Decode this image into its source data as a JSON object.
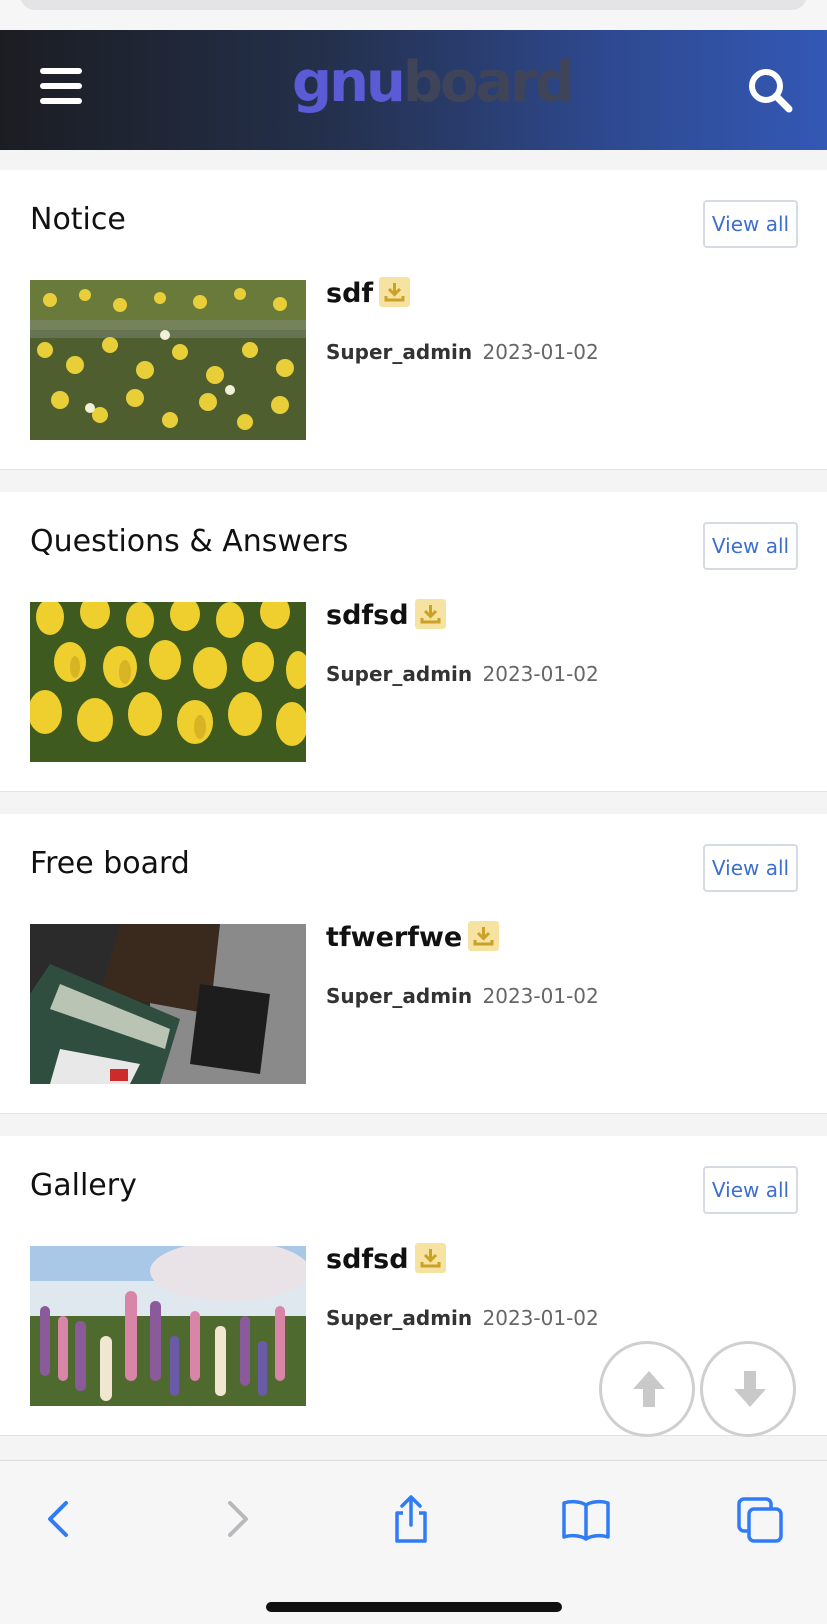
{
  "header": {
    "logo_part1": "gnu",
    "logo_part2": "board"
  },
  "view_all_label": "View all",
  "sections": [
    {
      "title": "Notice",
      "post": {
        "title": "sdf",
        "author": "Super_admin",
        "date": "2023-01-02"
      }
    },
    {
      "title": "Questions & Answers",
      "post": {
        "title": "sdfsd",
        "author": "Super_admin",
        "date": "2023-01-02"
      }
    },
    {
      "title": "Free board",
      "post": {
        "title": "tfwerfwe",
        "author": "Super_admin",
        "date": "2023-01-02"
      }
    },
    {
      "title": "Gallery",
      "post": {
        "title": "sdfsd",
        "author": "Super_admin",
        "date": "2023-01-02"
      }
    }
  ],
  "icons": {
    "menu": "hamburger-menu-icon",
    "search": "search-icon",
    "attachment": "download-icon",
    "scroll_top": "arrow-up-icon",
    "scroll_bottom": "arrow-down-icon",
    "back": "chevron-left-icon",
    "forward": "chevron-right-icon",
    "share": "share-icon",
    "bookmarks": "book-icon",
    "tabs": "tabs-icon"
  },
  "colors": {
    "accent": "#3d6fcf",
    "header_start": "#1b1d22",
    "header_end": "#3358b5",
    "attachment_badge": "#f6e3a2",
    "safari_blue": "#2f7cf6"
  }
}
